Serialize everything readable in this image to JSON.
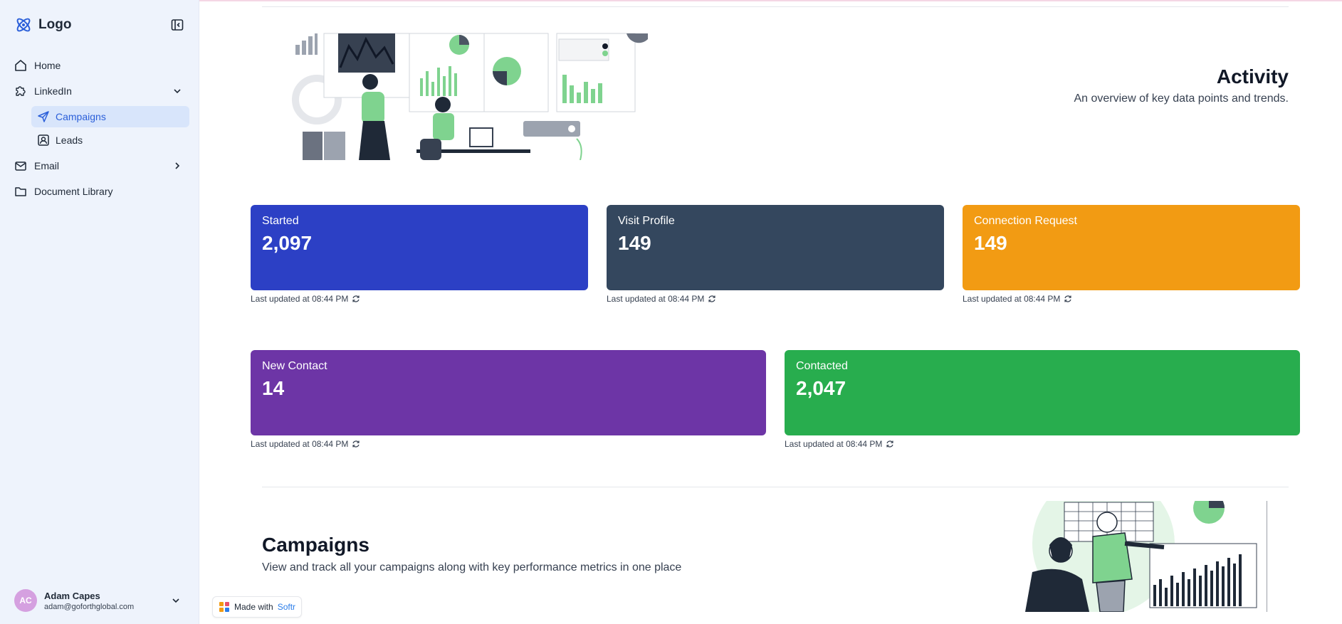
{
  "sidebar": {
    "logo_text": "Logo",
    "nav": {
      "home": "Home",
      "linkedin": "LinkedIn",
      "campaigns": "Campaigns",
      "leads": "Leads",
      "email": "Email",
      "document_library": "Document Library"
    },
    "user": {
      "initials": "AC",
      "name": "Adam Capes",
      "email": "adam@goforthglobal.com"
    }
  },
  "activity": {
    "title": "Activity",
    "subtitle": "An overview of key data points and trends."
  },
  "stats": [
    {
      "label": "Started",
      "value": "2,097",
      "updated": "Last updated at 08:44 PM",
      "color": "#2c40c5"
    },
    {
      "label": "Visit Profile",
      "value": "149",
      "updated": "Last updated at 08:44 PM",
      "color": "#34475e"
    },
    {
      "label": "Connection Request",
      "value": "149",
      "updated": "Last updated at 08:44 PM",
      "color": "#f29b13"
    },
    {
      "label": "New Contact",
      "value": "14",
      "updated": "Last updated at 08:44 PM",
      "color": "#6d35a6"
    },
    {
      "label": "Contacted",
      "value": "2,047",
      "updated": "Last updated at 08:44 PM",
      "color": "#28ad4e"
    }
  ],
  "campaigns": {
    "title": "Campaigns",
    "subtitle": "View and track all your campaigns along with key performance metrics in one place"
  },
  "badge": {
    "made_with": "Made with",
    "brand": "Softr"
  },
  "colors": {
    "accent": "#2b5fd9",
    "sidebar_bg": "#eef3fc",
    "illustration_green": "#7fd38f"
  }
}
